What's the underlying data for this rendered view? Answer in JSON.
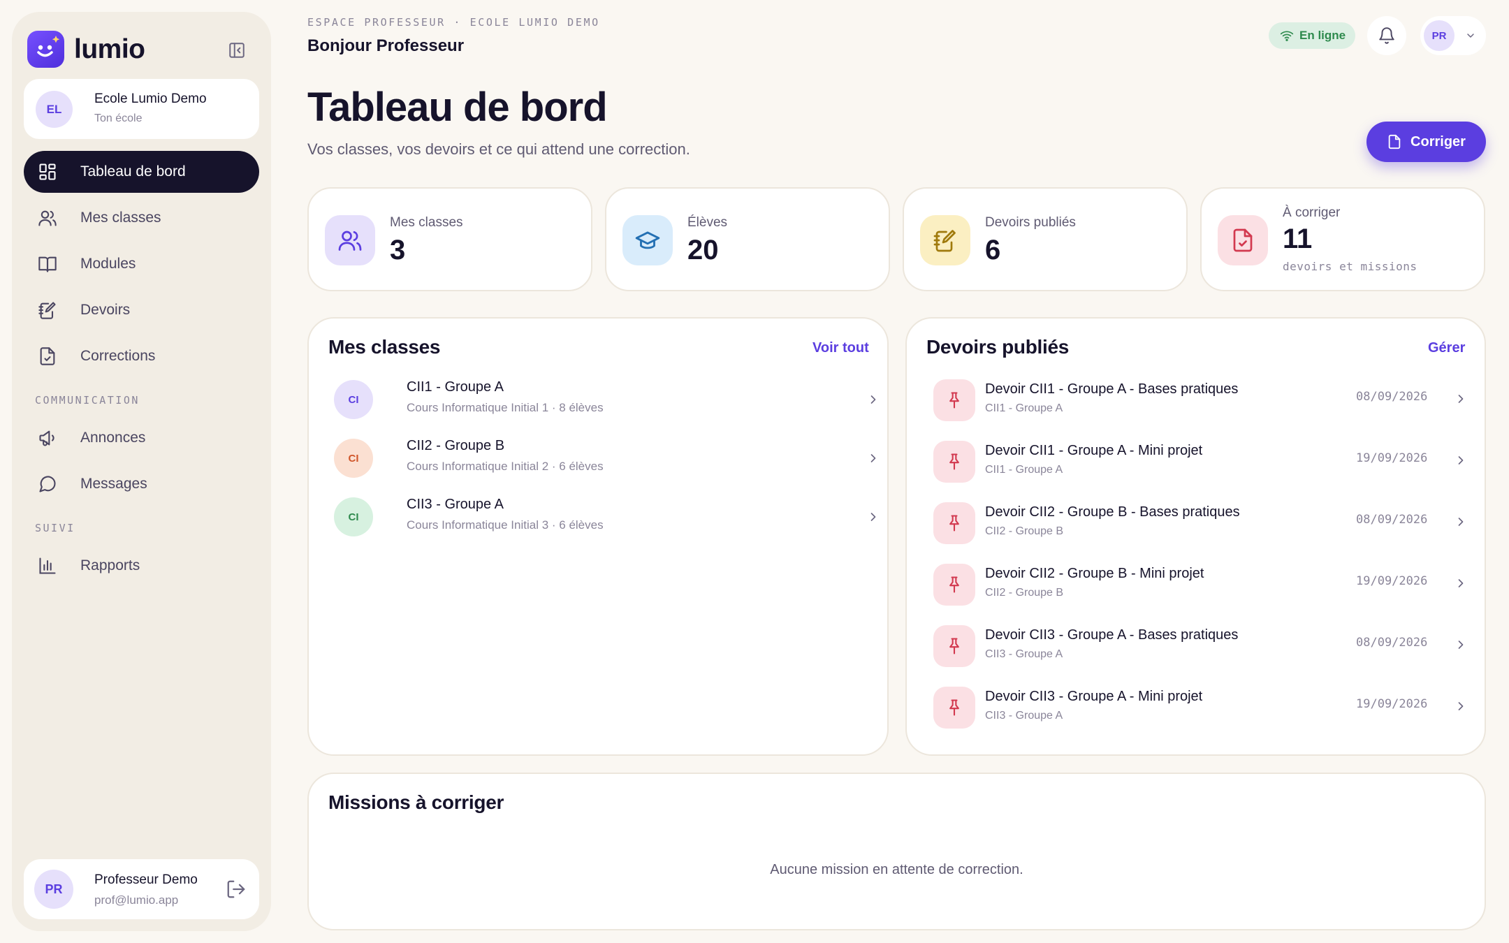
{
  "sidebar": {
    "brand": "lumio",
    "school": {
      "initials": "EL",
      "name": "Ecole Lumio Demo",
      "subtitle": "Ton école"
    },
    "nav": [
      {
        "label": "Tableau de bord",
        "icon": "dashboard-icon",
        "active": true
      },
      {
        "label": "Mes classes",
        "icon": "users-icon"
      },
      {
        "label": "Modules",
        "icon": "book-icon"
      },
      {
        "label": "Devoirs",
        "icon": "notebook-icon"
      },
      {
        "label": "Corrections",
        "icon": "file-check-icon"
      }
    ],
    "sections": [
      {
        "title": "COMMUNICATION",
        "items": [
          {
            "label": "Annonces",
            "icon": "megaphone-icon"
          },
          {
            "label": "Messages",
            "icon": "message-icon"
          }
        ]
      },
      {
        "title": "SUIVI",
        "items": [
          {
            "label": "Rapports",
            "icon": "bar-chart-icon"
          }
        ]
      }
    ],
    "user": {
      "initials": "PR",
      "name": "Professeur Demo",
      "email": "prof@lumio.app"
    }
  },
  "header": {
    "eyebrow": "ESPACE PROFESSEUR · ECOLE LUMIO DEMO",
    "greeting": "Bonjour Professeur",
    "status": "En ligne",
    "profile_initials": "PR"
  },
  "page": {
    "title": "Tableau de bord",
    "subtitle": "Vos classes, vos devoirs et ce qui attend une correction.",
    "action_label": "Corriger"
  },
  "stats": [
    {
      "label": "Mes classes",
      "value": "3",
      "icon": "users-icon",
      "bg": "#e6e0fb"
    },
    {
      "label": "Élèves",
      "value": "20",
      "icon": "graduation-cap-icon",
      "bg": "#d9ecfb"
    },
    {
      "label": "Devoirs publiés",
      "value": "6",
      "icon": "notebook-icon",
      "bg": "#fbefc2"
    },
    {
      "label": "À corriger",
      "value": "11",
      "note": "devoirs et missions",
      "icon": "file-check-icon",
      "bg": "#fbe0e4"
    }
  ],
  "classes_panel": {
    "title": "Mes classes",
    "link": "Voir tout",
    "items": [
      {
        "initials": "CI",
        "name": "CII1 - Groupe A",
        "detail": "Cours Informatique Initial 1 · 8 élèves",
        "bg": "#e6e0fb",
        "fg": "#5b3ee0"
      },
      {
        "initials": "CI",
        "name": "CII2 - Groupe B",
        "detail": "Cours Informatique Initial 2 · 6 élèves",
        "bg": "#fbe0d2",
        "fg": "#d0562a"
      },
      {
        "initials": "CI",
        "name": "CII3 - Groupe A",
        "detail": "Cours Informatique Initial 3 · 6 élèves",
        "bg": "#d7f1e0",
        "fg": "#2e8a4d"
      }
    ]
  },
  "homework_panel": {
    "title": "Devoirs publiés",
    "link": "Gérer",
    "items": [
      {
        "name": "Devoir CII1 - Groupe A - Bases pratiques",
        "group": "CII1 - Groupe A",
        "date": "08/09/2026"
      },
      {
        "name": "Devoir CII1 - Groupe A - Mini projet",
        "group": "CII1 - Groupe A",
        "date": "19/09/2026"
      },
      {
        "name": "Devoir CII2 - Groupe B - Bases pratiques",
        "group": "CII2 - Groupe B",
        "date": "08/09/2026"
      },
      {
        "name": "Devoir CII2 - Groupe B - Mini projet",
        "group": "CII2 - Groupe B",
        "date": "19/09/2026"
      },
      {
        "name": "Devoir CII3 - Groupe A - Bases pratiques",
        "group": "CII3 - Groupe A",
        "date": "08/09/2026"
      },
      {
        "name": "Devoir CII3 - Groupe A - Mini projet",
        "group": "CII3 - Groupe A",
        "date": "19/09/2026"
      }
    ]
  },
  "missions_panel": {
    "title": "Missions à corriger",
    "empty": "Aucune mission en attente de correction."
  },
  "colors": {
    "accent": "#5b3ee0",
    "ink": "#16132b",
    "background": "#faf7f2",
    "online": "#2e8a4d"
  }
}
